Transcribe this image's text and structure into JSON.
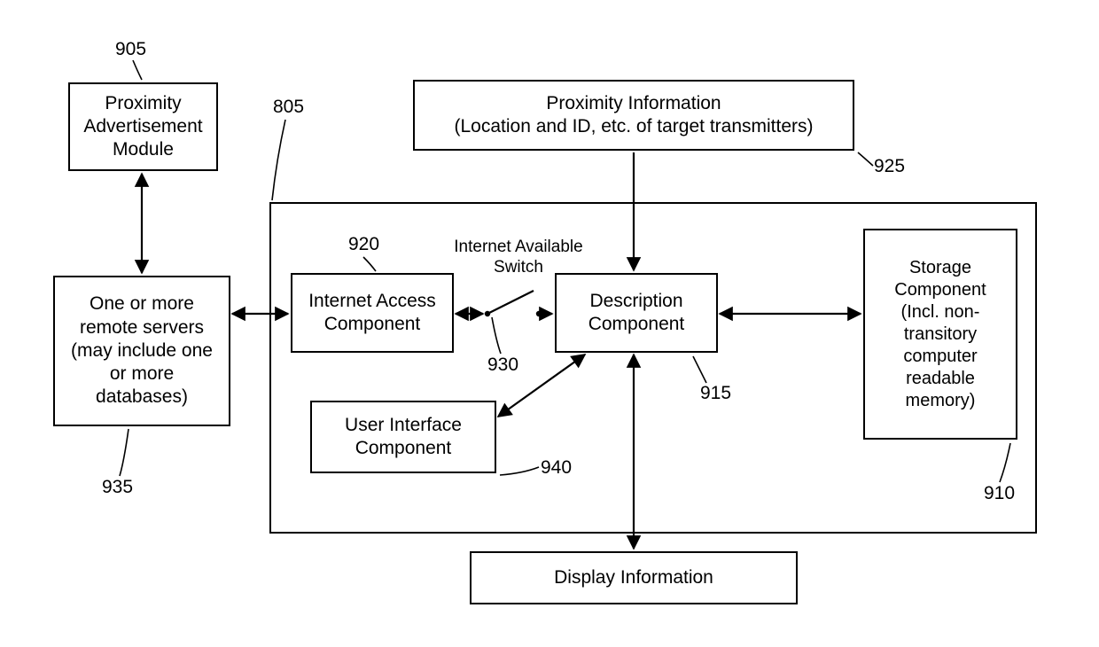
{
  "blocks": {
    "proximity_ad_module": "Proximity\nAdvertisement\nModule",
    "remote_servers": "One or more\nremote servers\n(may include one\nor more\ndatabases)",
    "proximity_info": "Proximity Information\n(Location and ID, etc. of target transmitters)",
    "internet_access": "Internet Access\nComponent",
    "description": "Description\nComponent",
    "storage": "Storage\nComponent\n(Incl. non-\ntransitory\ncomputer\nreadable\nmemory)",
    "user_interface": "User Interface\nComponent",
    "display_info": "Display Information"
  },
  "labels": {
    "switch": "Internet Available\nSwitch"
  },
  "refs": {
    "r905": "905",
    "r805": "805",
    "r920": "920",
    "r925": "925",
    "r930": "930",
    "r915": "915",
    "r935": "935",
    "r940": "940",
    "r910": "910"
  }
}
